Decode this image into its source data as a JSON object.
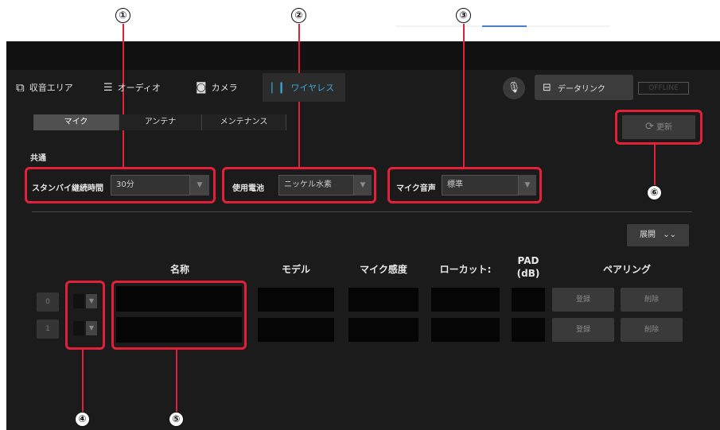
{
  "callouts": [
    "①",
    "②",
    "③",
    "④",
    "⑤",
    "⑥"
  ],
  "tabs": [
    {
      "label": "収音エリア",
      "icon": "grid-icon"
    },
    {
      "label": "オーディオ",
      "icon": "mixer-icon"
    },
    {
      "label": "カメラ",
      "icon": "camera-icon"
    },
    {
      "label": "ワイヤレス",
      "icon": "wireless-icon"
    }
  ],
  "header": {
    "mic_icon": "microphone-icon",
    "datalink_label": "データリンク",
    "datalink_icon": "network-icon",
    "status": "OFFLINE"
  },
  "subtabs": [
    "マイク",
    "アンテナ",
    "メンテナンス"
  ],
  "refresh": {
    "label": "更新",
    "icon": "refresh-icon"
  },
  "common": {
    "title": "共通",
    "standby": {
      "label": "スタンバイ継続時間",
      "value": "30分"
    },
    "battery": {
      "label": "使用電池",
      "value": "ニッケル水素"
    },
    "mic_voice": {
      "label": "マイク音声",
      "value": "標準"
    }
  },
  "expand": {
    "label": "展開",
    "icon": "double-chevron-down-icon"
  },
  "table": {
    "headers": [
      "名称",
      "モデル",
      "マイク感度",
      "ローカット:",
      "PAD (dB)",
      "ペアリング"
    ],
    "rows": [
      {
        "num": "0",
        "register": "登録",
        "delete": "削除"
      },
      {
        "num": "1",
        "register": "登録",
        "delete": "削除"
      }
    ]
  }
}
